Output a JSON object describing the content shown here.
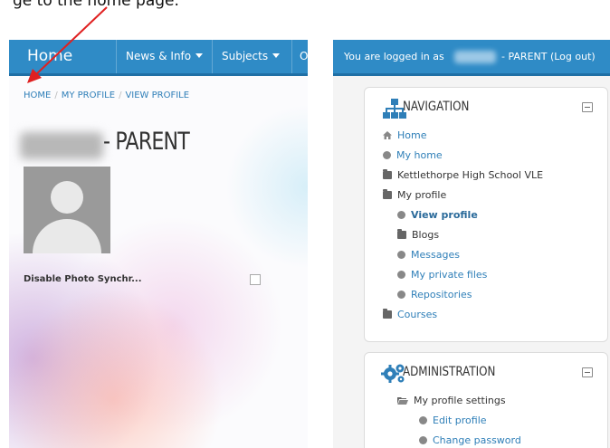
{
  "caption": {
    "text": "ge to the home page."
  },
  "left_panel": {
    "navbar": {
      "home": "Home",
      "news": "News & Info",
      "subjects": "Subjects",
      "more": "Our"
    },
    "breadcrumb": [
      "HOME",
      "MY PROFILE",
      "VIEW PROFILE"
    ],
    "title_suffix": "- PARENT",
    "photo_setting_label": "Disable Photo Synchr..."
  },
  "right_panel": {
    "login": {
      "prefix": "You are logged in as",
      "suffix": "- PARENT (Log out)"
    },
    "navigation": {
      "title": "NAVIGATION",
      "items": [
        {
          "label": "Home",
          "level": 1,
          "icon": "home-icon",
          "style": "link"
        },
        {
          "label": "My home",
          "level": 1,
          "icon": "dot-icon",
          "style": "link"
        },
        {
          "label": "Kettlethorpe High School VLE",
          "level": 1,
          "icon": "folder-icon",
          "style": "plain"
        },
        {
          "label": "My profile",
          "level": 1,
          "icon": "folder-icon",
          "style": "plain"
        },
        {
          "label": "View profile",
          "level": 2,
          "icon": "dot-icon",
          "style": "strong"
        },
        {
          "label": "Blogs",
          "level": 2,
          "icon": "folder-icon",
          "style": "plain"
        },
        {
          "label": "Messages",
          "level": 2,
          "icon": "dot-icon",
          "style": "link"
        },
        {
          "label": "My private files",
          "level": 2,
          "icon": "dot-icon",
          "style": "link"
        },
        {
          "label": "Repositories",
          "level": 2,
          "icon": "dot-icon",
          "style": "link"
        },
        {
          "label": "Courses",
          "level": 1,
          "icon": "folder-icon",
          "style": "link"
        }
      ]
    },
    "administration": {
      "title": "ADMINISTRATION",
      "items": [
        {
          "label": "My profile settings",
          "level": 1,
          "icon": "open-folder-icon",
          "style": "plain"
        },
        {
          "label": "Edit profile",
          "level": 2,
          "icon": "dot-icon",
          "style": "link"
        },
        {
          "label": "Change password",
          "level": 2,
          "icon": "dot-icon",
          "style": "link"
        }
      ]
    }
  },
  "colors": {
    "navbar_blue": "#2f8bc6",
    "link_blue": "#2f7fb8",
    "arrow_red": "#e02020"
  }
}
